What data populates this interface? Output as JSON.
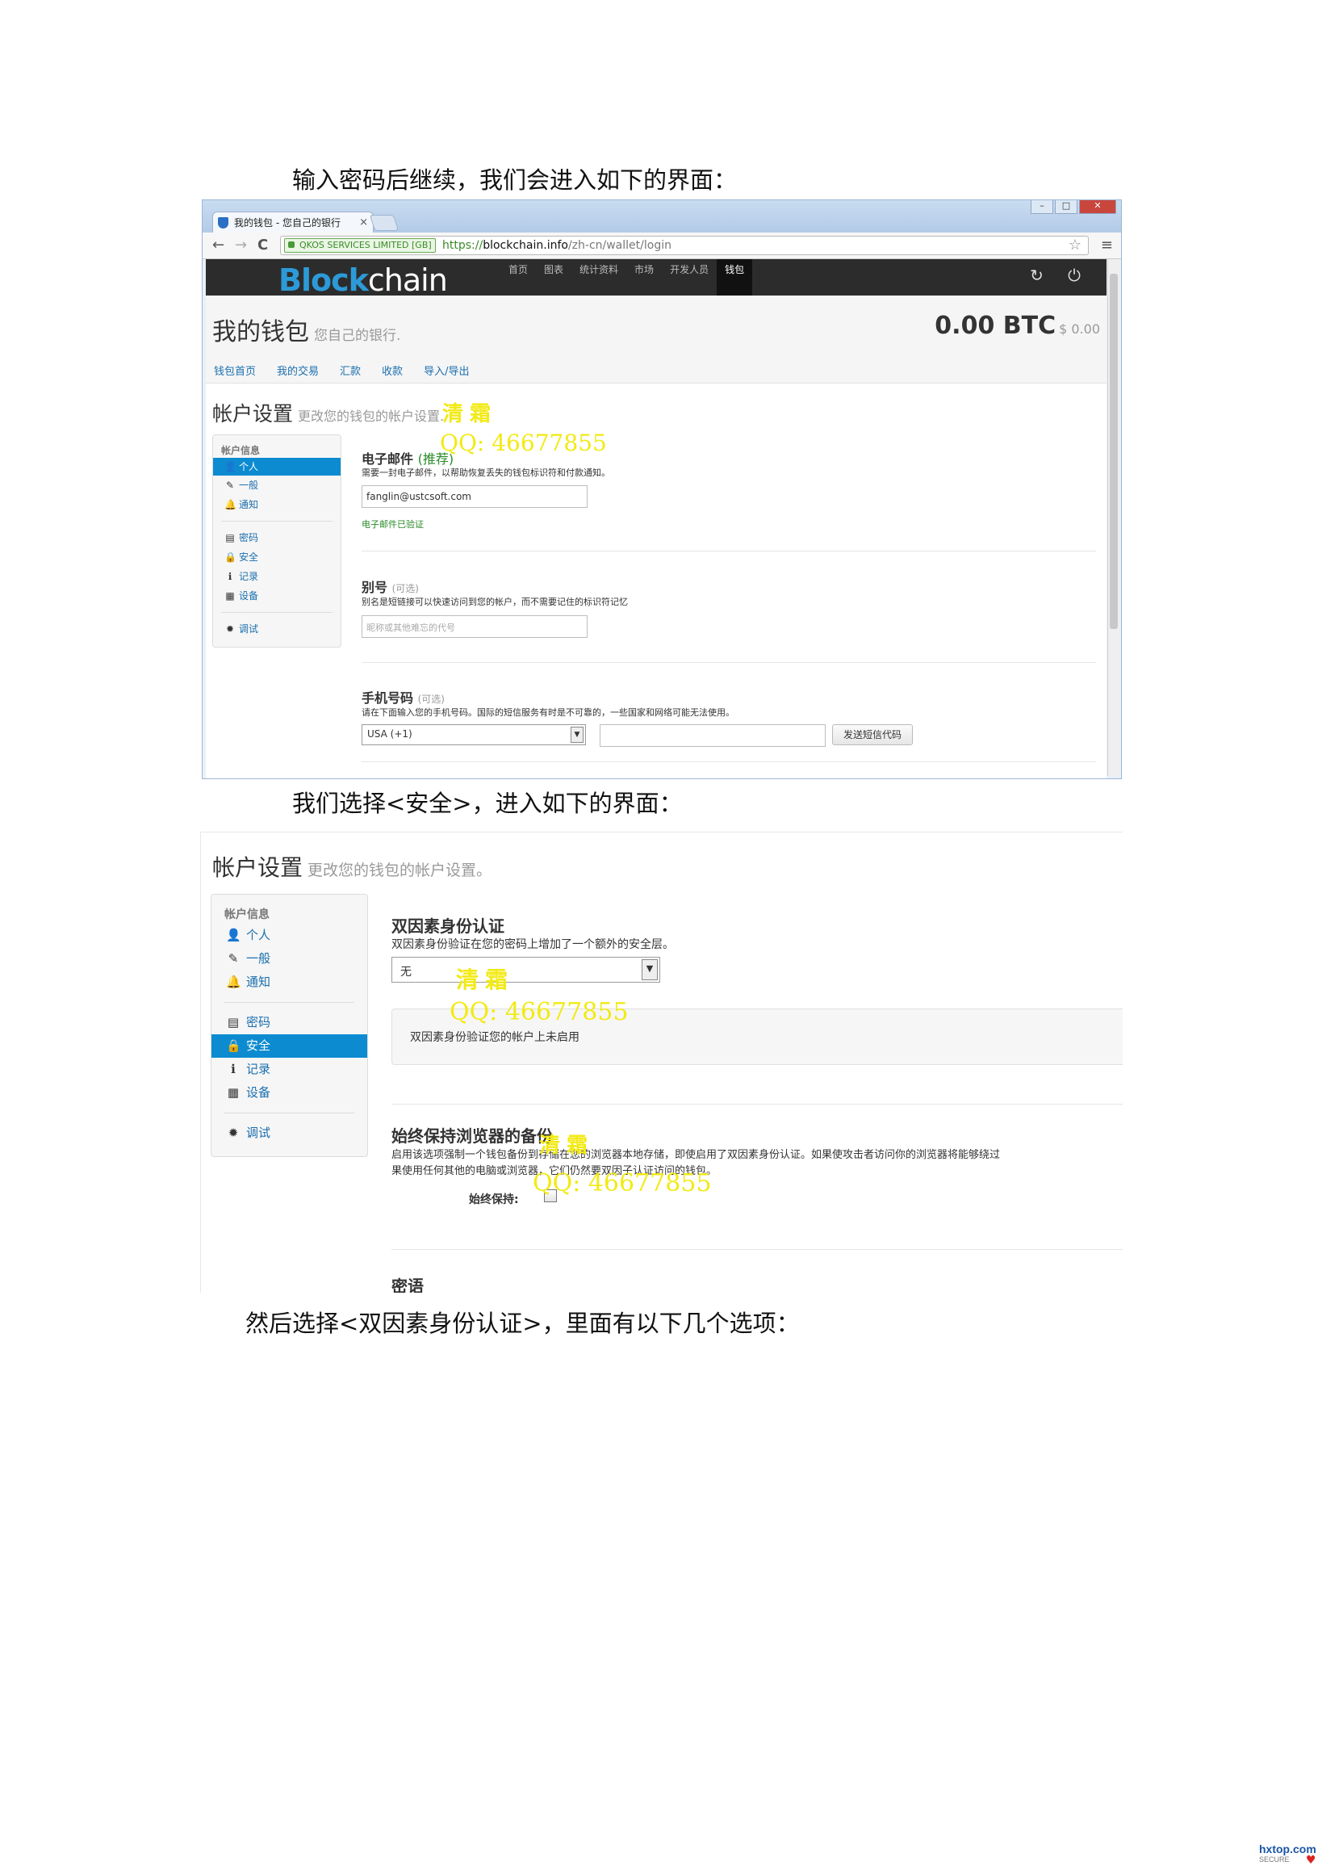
{
  "document": {
    "line1": "输入密码后继续，我们会进入如下的界面：",
    "line2": "我们选择<安全>，进入如下的界面：",
    "line3": "然后选择<双因素身份认证>，里面有以下几个选项："
  },
  "watermark": {
    "name": "清霜",
    "qq": "QQ: 46677855"
  },
  "browser": {
    "tab_title": "我的钱包 - 您自己的银行",
    "tab_close": "×",
    "back": "←",
    "forward": "→",
    "reload": "C",
    "ev_cert": "QKOS SERVICES LIMITED [GB]",
    "url_scheme": "https://",
    "url_host": "blockchain.info",
    "url_path": "/zh-cn/wallet/login",
    "star": "☆",
    "menu": "≡",
    "win_min": "–",
    "win_max": "□",
    "win_close": "✕"
  },
  "site": {
    "logo_pre": "Bl",
    "logo_mid": "ock",
    "logo_post": "chain",
    "nav": [
      "首页",
      "图表",
      "统计资料",
      "市场",
      "开发人员",
      "钱包"
    ],
    "nav_icons": "↻ ⏻",
    "wallet_title": "我的钱包",
    "wallet_subtitle": "您自己的银行.",
    "balance": "0.00 BTC",
    "balance_usd": "$ 0.00",
    "subnav": [
      "钱包首页",
      "我的交易",
      "汇款",
      "收款",
      "导入/导出"
    ]
  },
  "account": {
    "title": "帐户设置",
    "subtitle_1": "更改您的钱包的帐户设置.",
    "subtitle_2": "更改您的钱包的帐户设置。"
  },
  "sidebar": {
    "header": "帐户信息",
    "items": [
      {
        "icon": "👤",
        "label": "个人"
      },
      {
        "icon": "✎",
        "label": "一般"
      },
      {
        "icon": "🔔",
        "label": "通知"
      },
      {
        "icon": "▤",
        "label": "密码"
      },
      {
        "icon": "🔒",
        "label": "安全"
      },
      {
        "icon": "ℹ",
        "label": "记录"
      },
      {
        "icon": "▦",
        "label": "设备"
      },
      {
        "icon": "✹",
        "label": "调试"
      }
    ]
  },
  "personal": {
    "email_title": "电子邮件",
    "email_note": "(推荐)",
    "email_desc": "需要一封电子邮件，以帮助恢复丢失的钱包标识符和付款通知。",
    "email_value": "fanglin@ustcsoft.com",
    "email_verified": "电子邮件已验证",
    "alias_title": "别号",
    "alias_note": "(可选)",
    "alias_desc": "别名是短链接可以快速访问到您的帐户，而不需要记住的标识符记忆",
    "alias_placeholder": "昵称或其他难忘的代号",
    "phone_title": "手机号码",
    "phone_note": "(可选)",
    "phone_desc": "请在下面输入您的手机号码。国际的短信服务有时是不可靠的，一些国家和网络可能无法使用。",
    "country": "USA (+1)",
    "send_sms": "发送短信代码"
  },
  "security": {
    "twofa_title": "双因素身份认证",
    "twofa_desc": "双因素身份验证在您的密码上增加了一个额外的安全层。",
    "twofa_selected": "无",
    "twofa_status": "双因素身份验证您的帐户上未启用",
    "backup_title": "始终保持浏览器的备份",
    "backup_desc_1": "启用该选项强制一个钱包备份到存储在您的浏览器本地存储，即使启用了双因素身份认证。如果使攻击者访问你的浏览器将能够绕过",
    "backup_desc_2": "果使用任何其他的电脑或浏览器，它们仍然要双因子认证访问的钱包。",
    "always_keep_label": "始终保持:",
    "passphrase_title": "密语"
  },
  "corner": {
    "site": "hxtop.com",
    "sub": "SECURE",
    "heart": "♥"
  }
}
